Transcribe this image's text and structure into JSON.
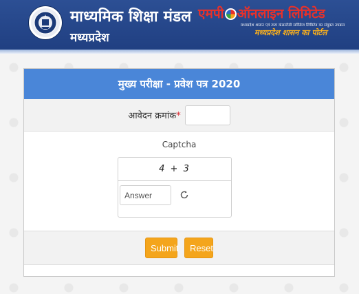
{
  "header": {
    "board_title": "माध्यमिक शिक्षा मंडल",
    "board_subtitle": "मध्यप्रदेश",
    "partner_name_part1": "एमपी",
    "partner_name_part2": "ऑनलाइन लिमिटेड",
    "partner_line": "मध्यप्रदेश शासन एवं टाटा कंसल्टेंसी सर्विसेज लिमिटेड का संयुक्त उपक्रम",
    "partner_tagline": "मध्यप्रदेश शासन का पोर्टल"
  },
  "form": {
    "title": "मुख्य परीक्षा - प्रवेश पत्र 2020",
    "application_label": "आवेदन क्रमांक",
    "required_marker": "*",
    "application_value": "",
    "captcha_title": "Captcha",
    "captcha_expression": "4 + 3",
    "answer_placeholder": "Answer",
    "submit_label": "Submit",
    "reset_label": "Reset"
  },
  "colors": {
    "header_bg": "#24468b",
    "panel_head_bg": "#4a86d8",
    "button_bg": "#f4a51c",
    "required": "#d9232a"
  },
  "icons": {
    "logo": "board-emblem-icon",
    "refresh": "refresh-icon"
  }
}
